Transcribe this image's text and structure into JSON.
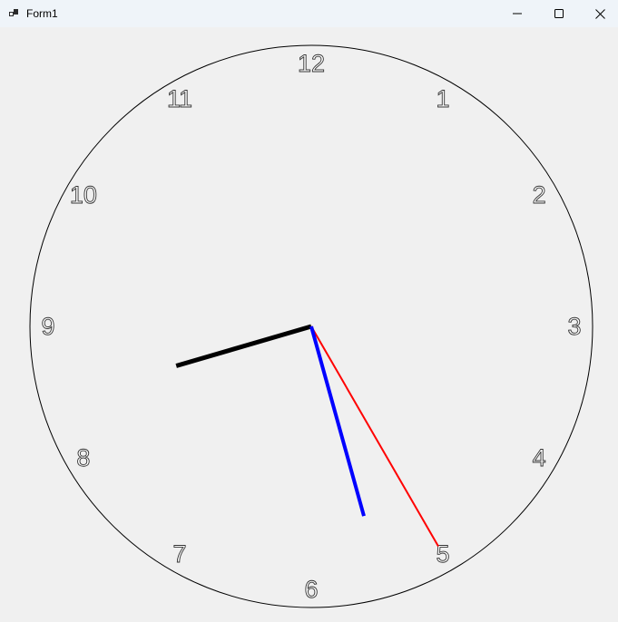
{
  "window": {
    "title": "Form1",
    "controls": {
      "minimize_icon": "minimize-icon",
      "maximize_icon": "maximize-icon",
      "close_icon": "close-icon"
    }
  },
  "clock": {
    "numerals": [
      "12",
      "1",
      "2",
      "3",
      "4",
      "5",
      "6",
      "7",
      "8",
      "9",
      "10",
      "11"
    ],
    "time": {
      "hour": 8,
      "minute": 27,
      "second": 25
    },
    "colors": {
      "face_outline": "#000000",
      "hour_hand": "#000000",
      "minute_hand": "#0000ff",
      "second_hand": "#ff0000"
    }
  }
}
